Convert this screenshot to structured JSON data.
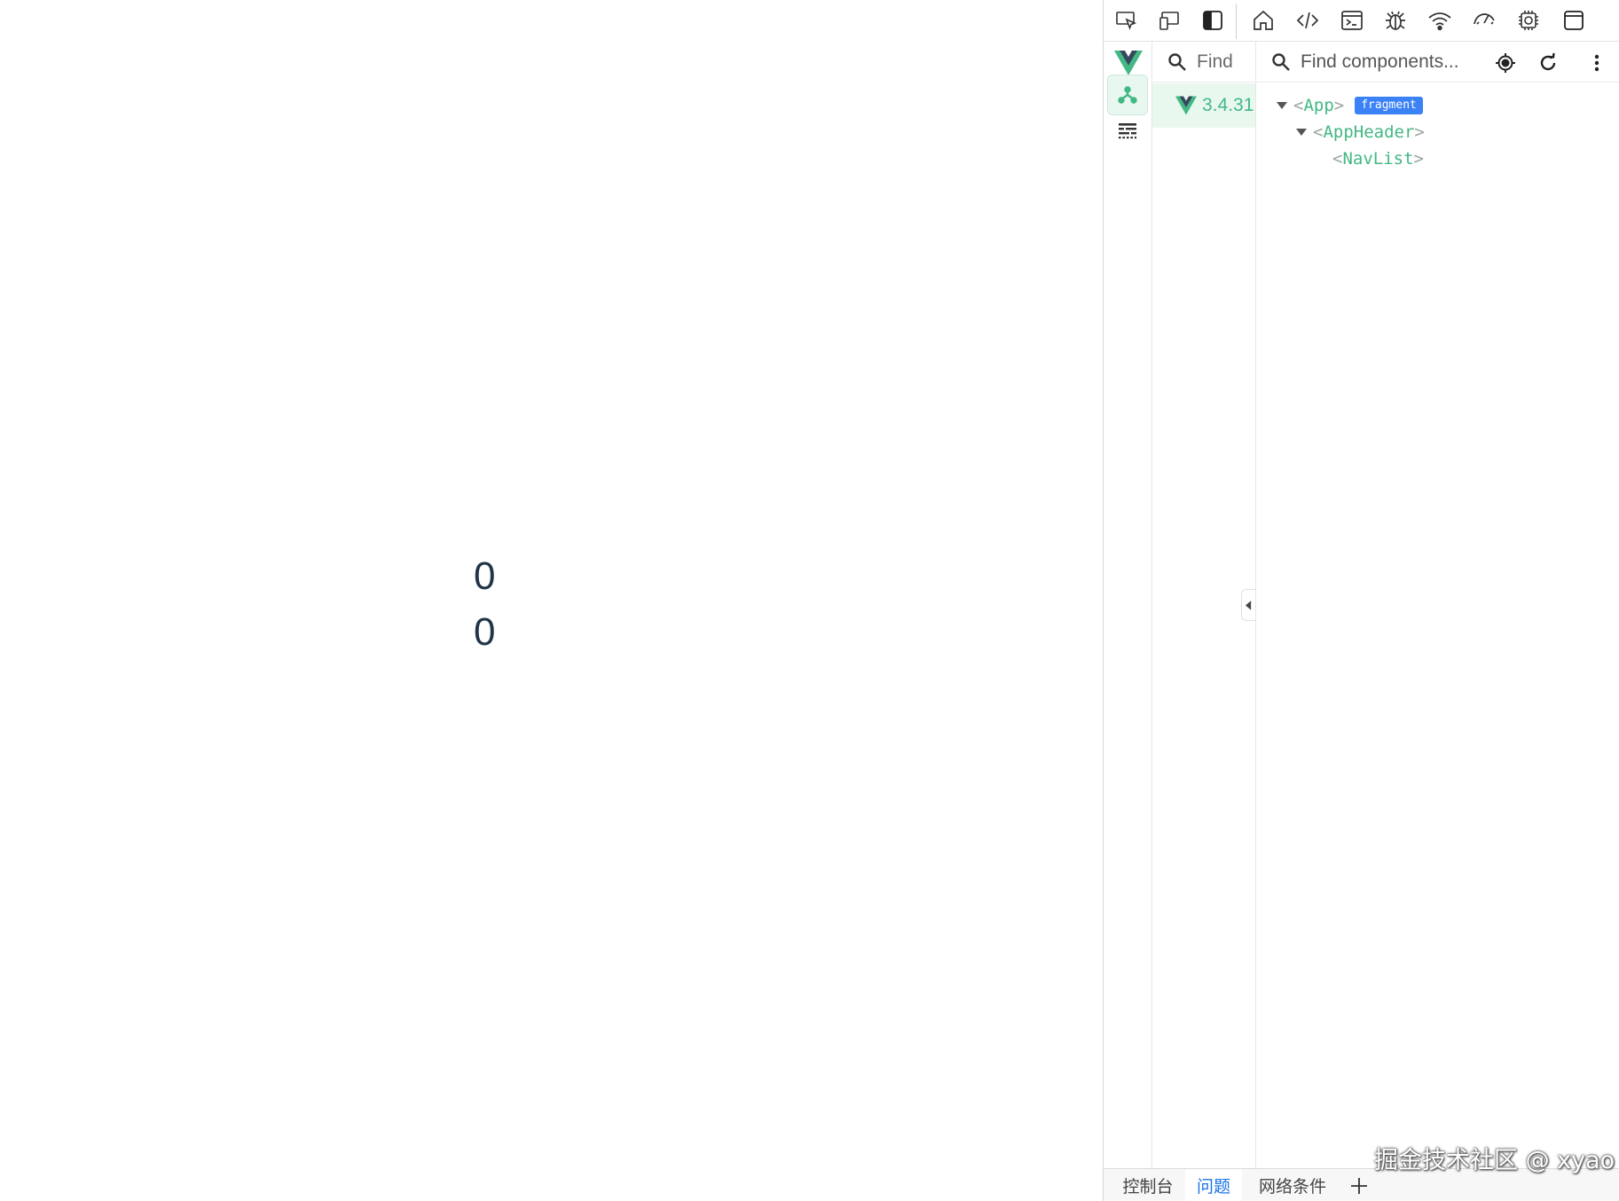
{
  "page": {
    "counters": [
      "0",
      "0"
    ]
  },
  "devtools": {
    "toolbar_icons": [
      "inspect-element-icon",
      "device-emulation-icon",
      "dock-side-icon",
      "welcome-home-icon",
      "elements-icon",
      "console-icon",
      "sources-debugger-icon",
      "network-icon",
      "performance-icon",
      "memory-icon",
      "application-icon"
    ],
    "vue": {
      "apps_search_placeholder": "Find",
      "app_version": "3.4.31",
      "components_search_placeholder": "Find components...",
      "tree": [
        {
          "name": "App",
          "badge": "fragment",
          "expanded": true,
          "depth": 0
        },
        {
          "name": "AppHeader",
          "expanded": true,
          "depth": 1
        },
        {
          "name": "NavList",
          "depth": 2
        }
      ],
      "accent_color": "#42b883",
      "badge_color": "#3b82f6"
    },
    "drawer_tabs": [
      {
        "label": "控制台",
        "active": false
      },
      {
        "label": "问题",
        "active": true
      },
      {
        "label": "网络条件",
        "active": false
      }
    ]
  },
  "watermark": "掘金技术社区 @ xyao"
}
